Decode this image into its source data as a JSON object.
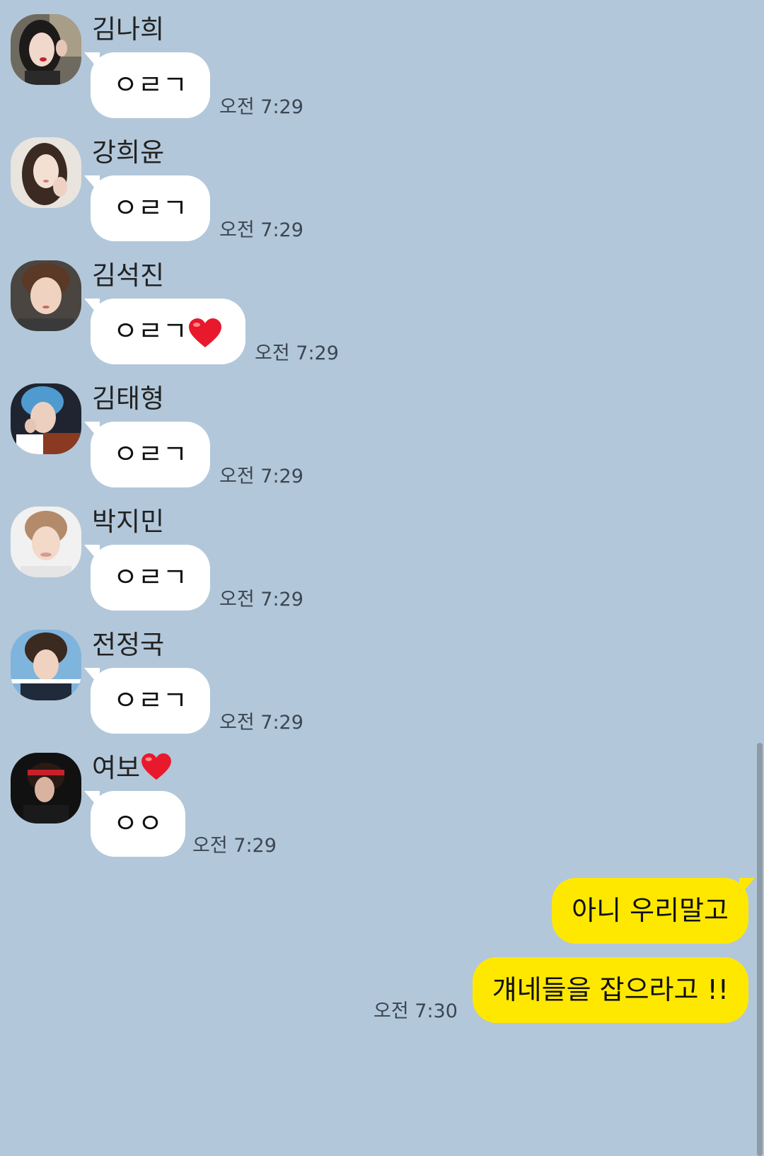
{
  "messages": [
    {
      "sender": "김나희",
      "text": "ㅇㄹㄱ",
      "time": "오전 7:29"
    },
    {
      "sender": "강희윤",
      "text": "ㅇㄹㄱ",
      "time": "오전 7:29"
    },
    {
      "sender": "김석진",
      "text": "ㅇㄹㄱ",
      "time": "오전 7:29",
      "heart": true
    },
    {
      "sender": "김태형",
      "text": "ㅇㄹㄱ",
      "time": "오전 7:29"
    },
    {
      "sender": "박지민",
      "text": "ㅇㄹㄱ",
      "time": "오전 7:29"
    },
    {
      "sender": "전정국",
      "text": "ㅇㄹㄱ",
      "time": "오전 7:29"
    },
    {
      "sender": "여보",
      "sender_heart": true,
      "text": "ㅇㅇ",
      "time": "오전 7:29"
    }
  ],
  "my_messages": [
    {
      "text": "아니 우리말고"
    },
    {
      "text": "걔네들을 잡으라고 !!",
      "time": "오전 7:30"
    }
  ],
  "colors": {
    "background": "#b2c7da",
    "incoming_bubble": "#ffffff",
    "outgoing_bubble": "#fee800",
    "heart": "#e8192c"
  }
}
